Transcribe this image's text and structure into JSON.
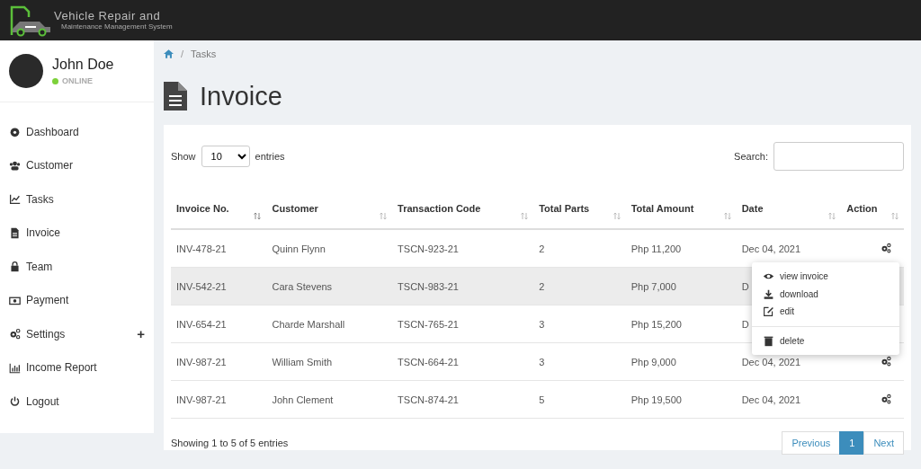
{
  "header": {
    "logo_title": "Vehicle Repair and",
    "logo_subtitle": "Maintenance Management System"
  },
  "user": {
    "name": "John Doe",
    "status": "ONLINE"
  },
  "sidebar": {
    "items": [
      {
        "label": "Dashboard"
      },
      {
        "label": "Customer"
      },
      {
        "label": "Tasks"
      },
      {
        "label": "Invoice"
      },
      {
        "label": "Team"
      },
      {
        "label": "Payment"
      },
      {
        "label": "Settings",
        "toggle": "+"
      },
      {
        "label": "Income Report"
      },
      {
        "label": "Logout"
      }
    ]
  },
  "breadcrumb": {
    "separator": "/",
    "label": "Tasks"
  },
  "page_title": "Invoice",
  "length_control": {
    "prefix": "Show",
    "value": "10",
    "suffix": "entries"
  },
  "search": {
    "label": "Search:"
  },
  "table": {
    "columns": [
      "Invoice No.",
      "Customer",
      "Transaction Code",
      "Total Parts",
      "Total Amount",
      "Date",
      "Action"
    ],
    "rows": [
      {
        "cells": [
          "INV-478-21",
          "Quinn Flynn",
          "TSCN-923-21",
          "2",
          "Php 11,200",
          "Dec 04, 2021"
        ],
        "selected": false
      },
      {
        "cells": [
          "INV-542-21",
          "Cara Stevens",
          "TSCN-983-21",
          "2",
          "Php 7,000",
          "D"
        ],
        "selected": true
      },
      {
        "cells": [
          "INV-654-21",
          "Charde Marshall",
          "TSCN-765-21",
          "3",
          "Php 15,200",
          "D"
        ],
        "selected": false
      },
      {
        "cells": [
          "INV-987-21",
          "William Smith",
          "TSCN-664-21",
          "3",
          "Php 9,000",
          "Dec 04, 2021"
        ],
        "selected": false
      },
      {
        "cells": [
          "INV-987-21",
          "John Clement",
          "TSCN-874-21",
          "5",
          "Php 19,500",
          "Dec 04, 2021"
        ],
        "selected": false
      }
    ]
  },
  "action_menu": {
    "items": [
      {
        "label": "view invoice"
      },
      {
        "label": "download"
      },
      {
        "label": "edit"
      },
      {
        "label": "delete"
      }
    ]
  },
  "info": "Showing 1 to 5 of 5 entries",
  "pagination": [
    {
      "label": "Previous",
      "selected": false
    },
    {
      "label": "1",
      "selected": true
    },
    {
      "label": "Next",
      "selected": false
    }
  ]
}
